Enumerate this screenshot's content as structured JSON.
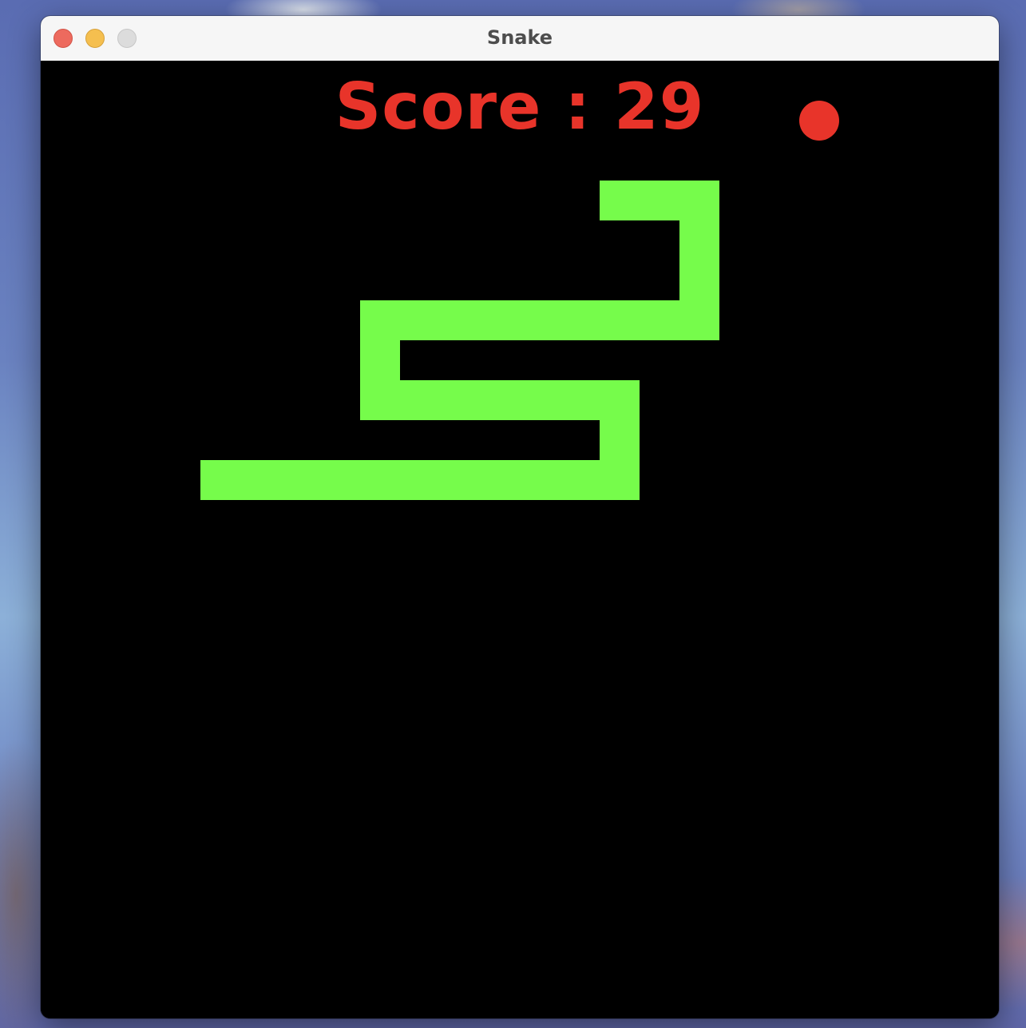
{
  "window": {
    "title": "Snake"
  },
  "score": {
    "label": "Score : ",
    "value": "29",
    "color": "#e8342a"
  },
  "colors": {
    "snake": "#76fc4b",
    "food": "#e8342a",
    "background": "#000000"
  },
  "grid": {
    "cell_count_x": 24,
    "cell_count_y": 24
  },
  "food": {
    "cell": [
      19,
      1
    ]
  },
  "snake": {
    "body": [
      [
        14,
        3
      ],
      [
        15,
        3
      ],
      [
        16,
        3
      ],
      [
        16,
        4
      ],
      [
        16,
        5
      ],
      [
        16,
        6
      ],
      [
        15,
        6
      ],
      [
        14,
        6
      ],
      [
        13,
        6
      ],
      [
        12,
        6
      ],
      [
        11,
        6
      ],
      [
        10,
        6
      ],
      [
        9,
        6
      ],
      [
        8,
        6
      ],
      [
        8,
        7
      ],
      [
        8,
        8
      ],
      [
        9,
        8
      ],
      [
        10,
        8
      ],
      [
        11,
        8
      ],
      [
        12,
        8
      ],
      [
        13,
        8
      ],
      [
        14,
        8
      ],
      [
        14,
        9
      ],
      [
        14,
        10
      ],
      [
        13,
        10
      ],
      [
        12,
        10
      ],
      [
        11,
        10
      ],
      [
        10,
        10
      ],
      [
        9,
        10
      ],
      [
        8,
        10
      ],
      [
        7,
        10
      ],
      [
        6,
        10
      ],
      [
        5,
        10
      ],
      [
        4,
        10
      ]
    ]
  }
}
